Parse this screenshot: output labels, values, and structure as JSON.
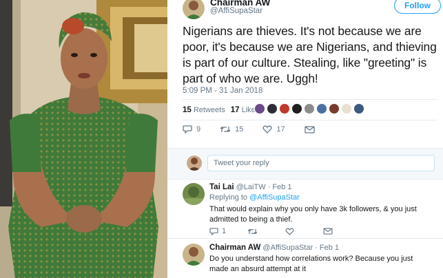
{
  "tweet": {
    "author_name": "Chairman AW",
    "author_handle": "@AffiSupaStar",
    "follow_label": "Follow",
    "text": "Nigerians are thieves. It's not because we are poor, it's because we are Nigerians, and thieving is part of our culture. Stealing, like \"greeting\" is part of who we are. Uggh!",
    "timestamp": "5:09 PM - 31 Jan 2018",
    "retweets_count": "15",
    "retweets_label": "Retweets",
    "likes_count": "17",
    "likes_label": "Likes",
    "actions": {
      "reply_count": "9",
      "retweet_count": "15",
      "like_count": "17"
    }
  },
  "reply_box": {
    "placeholder": "Tweet your reply"
  },
  "replies": [
    {
      "name": "Tai Lai",
      "handle_date": "@LaiTW · Feb 1",
      "replying_prefix": "Replying to",
      "replying_to": "@AffiSupaStar",
      "text": "That would explain why you only have 3k followers, & you just admitted to being a thief.",
      "reply_count": "1"
    },
    {
      "name": "Chairman AW",
      "handle_date": "@AffiSupaStar · Feb 1",
      "text": "Do you understand how correlations work? Because you just made an absurd attempt at it"
    }
  ],
  "colors": {
    "accent": "#1da1f2",
    "muted": "#657786",
    "text": "#14171a",
    "divider": "#e6ecf0"
  }
}
